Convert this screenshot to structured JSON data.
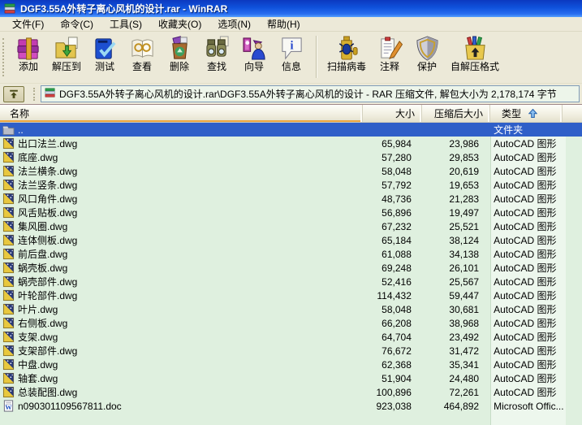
{
  "window": {
    "title": "DGF3.55A外转子离心风机的设计.rar - WinRAR"
  },
  "menu": {
    "items": [
      {
        "label": "文件(F)"
      },
      {
        "label": "命令(C)"
      },
      {
        "label": "工具(S)"
      },
      {
        "label": "收藏夹(O)"
      },
      {
        "label": "选项(N)"
      },
      {
        "label": "帮助(H)"
      }
    ]
  },
  "toolbar": {
    "buttons": [
      {
        "label": "添加",
        "icon": "add-archive-icon"
      },
      {
        "label": "解压到",
        "icon": "extract-to-icon"
      },
      {
        "label": "测试",
        "icon": "test-archive-icon"
      },
      {
        "label": "查看",
        "icon": "view-file-icon"
      },
      {
        "label": "删除",
        "icon": "delete-icon"
      },
      {
        "label": "查找",
        "icon": "find-icon"
      },
      {
        "label": "向导",
        "icon": "wizard-icon"
      },
      {
        "label": "信息",
        "icon": "info-icon"
      },
      {
        "label": "扫描病毒",
        "icon": "scan-virus-icon"
      },
      {
        "label": "注释",
        "icon": "comment-icon"
      },
      {
        "label": "保护",
        "icon": "protect-icon"
      },
      {
        "label": "自解压格式",
        "icon": "sfx-icon"
      }
    ]
  },
  "address": {
    "text": "DGF3.55A外转子离心风机的设计.rar\\DGF3.55A外转子离心风机的设计 - RAR 压缩文件, 解包大小为 2,178,174 字节"
  },
  "columns": {
    "name": "名称",
    "size": "大小",
    "packed": "压缩后大小",
    "type": "类型",
    "sort_direction": "ascending"
  },
  "rows": [
    {
      "name": "..",
      "size": "",
      "packed": "",
      "type": "文件夹",
      "icon": "folder",
      "selected": true
    },
    {
      "name": "出口法兰.dwg",
      "size": "65,984",
      "packed": "23,986",
      "type": "AutoCAD 图形",
      "icon": "dwg",
      "selected": false
    },
    {
      "name": "底座.dwg",
      "size": "57,280",
      "packed": "29,853",
      "type": "AutoCAD 图形",
      "icon": "dwg",
      "selected": false
    },
    {
      "name": "法兰横条.dwg",
      "size": "58,048",
      "packed": "20,619",
      "type": "AutoCAD 图形",
      "icon": "dwg",
      "selected": false
    },
    {
      "name": "法兰竖条.dwg",
      "size": "57,792",
      "packed": "19,653",
      "type": "AutoCAD 图形",
      "icon": "dwg",
      "selected": false
    },
    {
      "name": "风口角件.dwg",
      "size": "48,736",
      "packed": "21,283",
      "type": "AutoCAD 图形",
      "icon": "dwg",
      "selected": false
    },
    {
      "name": "风舌贴板.dwg",
      "size": "56,896",
      "packed": "19,497",
      "type": "AutoCAD 图形",
      "icon": "dwg",
      "selected": false
    },
    {
      "name": "集风圈.dwg",
      "size": "67,232",
      "packed": "25,521",
      "type": "AutoCAD 图形",
      "icon": "dwg",
      "selected": false
    },
    {
      "name": "连体侧板.dwg",
      "size": "65,184",
      "packed": "38,124",
      "type": "AutoCAD 图形",
      "icon": "dwg",
      "selected": false
    },
    {
      "name": "前后盘.dwg",
      "size": "61,088",
      "packed": "34,138",
      "type": "AutoCAD 图形",
      "icon": "dwg",
      "selected": false
    },
    {
      "name": "蜗壳板.dwg",
      "size": "69,248",
      "packed": "26,101",
      "type": "AutoCAD 图形",
      "icon": "dwg",
      "selected": false
    },
    {
      "name": "蜗壳部件.dwg",
      "size": "52,416",
      "packed": "25,567",
      "type": "AutoCAD 图形",
      "icon": "dwg",
      "selected": false
    },
    {
      "name": "叶轮部件.dwg",
      "size": "114,432",
      "packed": "59,447",
      "type": "AutoCAD 图形",
      "icon": "dwg",
      "selected": false
    },
    {
      "name": "叶片.dwg",
      "size": "58,048",
      "packed": "30,681",
      "type": "AutoCAD 图形",
      "icon": "dwg",
      "selected": false
    },
    {
      "name": "右侧板.dwg",
      "size": "66,208",
      "packed": "38,968",
      "type": "AutoCAD 图形",
      "icon": "dwg",
      "selected": false
    },
    {
      "name": "支架.dwg",
      "size": "64,704",
      "packed": "23,492",
      "type": "AutoCAD 图形",
      "icon": "dwg",
      "selected": false
    },
    {
      "name": "支架部件.dwg",
      "size": "76,672",
      "packed": "31,472",
      "type": "AutoCAD 图形",
      "icon": "dwg",
      "selected": false
    },
    {
      "name": "中盘.dwg",
      "size": "62,368",
      "packed": "35,341",
      "type": "AutoCAD 图形",
      "icon": "dwg",
      "selected": false
    },
    {
      "name": "轴套.dwg",
      "size": "51,904",
      "packed": "24,480",
      "type": "AutoCAD 图形",
      "icon": "dwg",
      "selected": false
    },
    {
      "name": "总装配图.dwg",
      "size": "100,896",
      "packed": "72,261",
      "type": "AutoCAD 图形",
      "icon": "dwg",
      "selected": false
    },
    {
      "name": "n090301109567811.doc",
      "size": "923,038",
      "packed": "464,892",
      "type": "Microsoft Offic...",
      "icon": "doc",
      "selected": false
    }
  ],
  "colors": {
    "titlebar_top": "#0c39c0",
    "titlebar_bottom": "#55a0ff",
    "chrome_bg": "#ECE9D8",
    "list_bg": "#DFF0DF",
    "sorted_column_bg": "#EDF7ED",
    "selection_bg": "#2F5FC8",
    "header_sort_underline": "#EDA53E",
    "combo_bg": "#EDF5EA"
  }
}
